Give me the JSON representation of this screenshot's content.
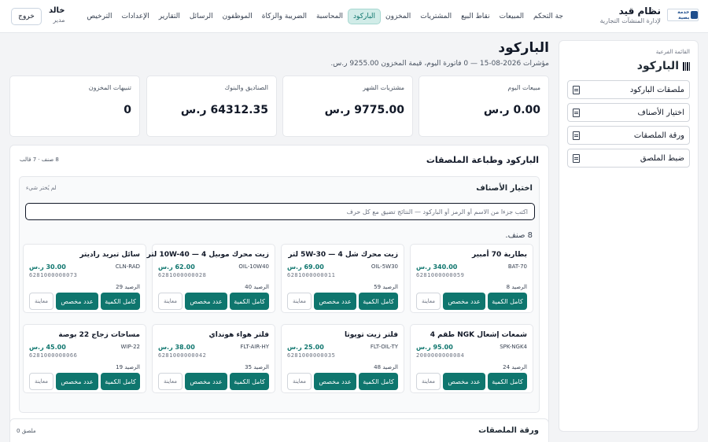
{
  "brand": {
    "logo_text": "خدمة بصية",
    "name": "نظام قيد",
    "subtitle": "لإدارة المنشآت التجارية"
  },
  "nav": [
    {
      "label": "جة التحكم",
      "active": false
    },
    {
      "label": "المبيعات",
      "active": false
    },
    {
      "label": "نقاط البيع",
      "active": false
    },
    {
      "label": "المشتريات",
      "active": false
    },
    {
      "label": "المخزون",
      "active": false
    },
    {
      "label": "الباركود",
      "active": true
    },
    {
      "label": "المحاسبة",
      "active": false
    },
    {
      "label": "الضريبة والزكاة",
      "active": false
    },
    {
      "label": "الموظفون",
      "active": false
    },
    {
      "label": "الرسائل",
      "active": false
    },
    {
      "label": "التقارير",
      "active": false
    },
    {
      "label": "الإعدادات",
      "active": false
    },
    {
      "label": "الترخيص",
      "active": false
    }
  ],
  "user": {
    "name": "خالد",
    "role": "مدير",
    "logout_label": "خروج"
  },
  "submenu": {
    "caption": "القائمة الفرعية",
    "title": "الباركود",
    "items": [
      "ملصقات الباركود",
      "اختيار الأصناف",
      "ورقة الملصقات",
      "ضبط الملصق"
    ]
  },
  "page": {
    "title": "الباركود",
    "subtitle": "مؤشرات 2026-08-15 — 0 فاتورة اليوم، قيمة المخزون 9255.00 ر.س."
  },
  "kpis": [
    {
      "label": "مبيعات اليوم",
      "value": "0.00 ر.س"
    },
    {
      "label": "مشتريات الشهر",
      "value": "9775.00 ر.س"
    },
    {
      "label": "الصناديق والبنوك",
      "value": "64312.35 ر.س"
    },
    {
      "label": "تنبيهات المخزون",
      "value": "0"
    }
  ],
  "labels_section": {
    "title": "الباركود وطباعة الملصقات",
    "meta": "8 صنف · 7 قالب",
    "picker": {
      "title": "اختيار الأصناف",
      "note": "لم يُختر شيء",
      "search_placeholder": "اكتب جزءا من الاسم أو الرمز أو الباركود — النتائج تضيق مع كل حرف",
      "count": "8 صنف.",
      "buttons": {
        "full": "كامل الكمية",
        "custom": "عدد مخصص",
        "preview": "معاينة"
      }
    }
  },
  "products": [
    {
      "name": "بطارية 70 أمبير",
      "code": "BAT-70",
      "price": "340.00 ر.س",
      "barcode": "6281000000059",
      "stock": "الرصيد 8"
    },
    {
      "name": "زيت محرك شل 4 — 5W-30 لتر",
      "code": "OIL-5W30",
      "price": "69.00 ر.س",
      "barcode": "6281000000011",
      "stock": "الرصيد 59"
    },
    {
      "name": "زيت محرك موبيل 4 — 10W-40 لتر",
      "code": "OIL-10W40",
      "price": "62.00 ر.س",
      "barcode": "6281000000028",
      "stock": "الرصيد 40"
    },
    {
      "name": "سائل تبريد راديتر",
      "code": "CLN-RAD",
      "price": "30.00 ر.س",
      "barcode": "6281000000073",
      "stock": "الرصيد 29"
    },
    {
      "name": "شمعات إشعال NGK طقم 4",
      "code": "SPK-NGK4",
      "price": "95.00 ر.س",
      "barcode": "2000000000084",
      "stock": "الرصيد 24"
    },
    {
      "name": "فلتر زيت تويوتا",
      "code": "FLT-OIL-TY",
      "price": "25.00 ر.س",
      "barcode": "6281000000035",
      "stock": "الرصيد 48"
    },
    {
      "name": "فلتر هواء هونداي",
      "code": "FLT-AIR-HY",
      "price": "38.00 ر.س",
      "barcode": "6281000000042",
      "stock": "الرصيد 35"
    },
    {
      "name": "مساحات زجاج 22 بوصة",
      "code": "WIP-22",
      "price": "45.00 ر.س",
      "barcode": "6281000000066",
      "stock": "الرصيد 19"
    }
  ],
  "sheet": {
    "title": "ورقة الملصقات",
    "meta": "ملصق 0"
  }
}
